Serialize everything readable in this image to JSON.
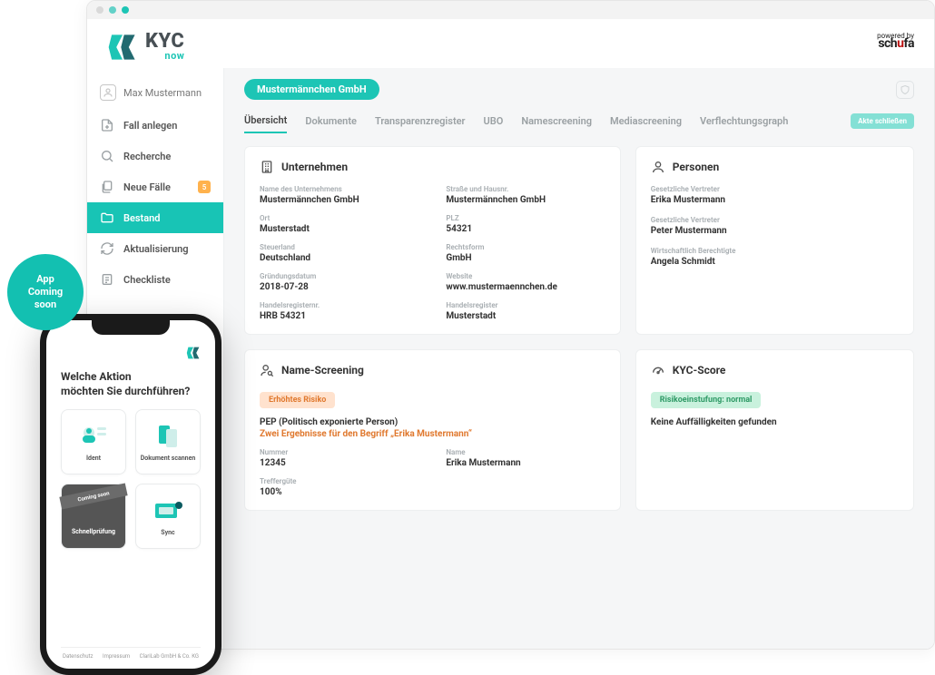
{
  "logo": {
    "kyc": "KYC",
    "now": "now"
  },
  "powered": {
    "label": "powered by",
    "brand_prefix": "sch",
    "brand_accent": "u",
    "brand_suffix": "fa"
  },
  "user": {
    "name": "Max Mustermann"
  },
  "sidebar": {
    "items": [
      {
        "label": "Fall anlegen"
      },
      {
        "label": "Recherche"
      },
      {
        "label": "Neue Fälle",
        "badge": "5"
      },
      {
        "label": "Bestand"
      },
      {
        "label": "Aktualisierung"
      },
      {
        "label": "Checkliste"
      }
    ]
  },
  "main": {
    "company_name": "Mustermännchen GmbH",
    "close_label": "Akte schließen",
    "tabs": [
      "Übersicht",
      "Dokumente",
      "Transparenzregister",
      "UBO",
      "Namescreening",
      "Mediascreening",
      "Verflechtungsgraph"
    ],
    "unternehmen": {
      "heading": "Unternehmen",
      "fields": {
        "name_l": "Name des Unternehmens",
        "name_v": "Mustermännchen GmbH",
        "street_l": "Straße und Hausnr.",
        "street_v": "Mustermännchen GmbH",
        "ort_l": "Ort",
        "ort_v": "Musterstadt",
        "plz_l": "PLZ",
        "plz_v": "54321",
        "land_l": "Steuerland",
        "land_v": "Deutschland",
        "form_l": "Rechtsform",
        "form_v": "GmbH",
        "grund_l": "Gründungsdatum",
        "grund_v": "2018-07-28",
        "web_l": "Website",
        "web_v": "www.mustermaennchen.de",
        "hrnr_l": "Handelsregisternr.",
        "hrnr_v": "HRB 54321",
        "hr_l": "Handelsregister",
        "hr_v": "Musterstadt"
      }
    },
    "personen": {
      "heading": "Personen",
      "list": [
        {
          "role": "Gesetzliche Vertreter",
          "name": "Erika Mustermann"
        },
        {
          "role": "Gesetzliche Vertreter",
          "name": "Peter Mustermann"
        },
        {
          "role": "Wirtschaftlich Berechtigte",
          "name": "Angela Schmidt"
        }
      ]
    },
    "namescreening": {
      "heading": "Name-Screening",
      "risk": "Erhöhtes Risiko",
      "pep_title": "PEP (Politisch exponierte Person)",
      "pep_sub": "Zwei Ergebnisse für den Begriff „Erika Mustermann“",
      "nr_l": "Nummer",
      "nr_v": "12345",
      "name_l": "Name",
      "name_v": "Erika Mustermann",
      "tg_l": "Treffergüte",
      "tg_v": "100%"
    },
    "kyc": {
      "heading": "KYC-Score",
      "risk": "Risikoeinstufung: normal",
      "text": "Keine Auffälligkeiten gefunden"
    }
  },
  "phone": {
    "title_l1": "Welche Aktion",
    "title_l2": "möchten Sie durchführen?",
    "cards": [
      {
        "cap": "Ident"
      },
      {
        "cap": "Dokument scannen"
      },
      {
        "cap": "Schnellprüfung",
        "dark": true,
        "ribbon": "Coming soon"
      },
      {
        "cap": "Sync"
      }
    ],
    "footer": [
      "Datenschutz",
      "Impressum",
      "ClariLab GmbH & Co. KG"
    ]
  },
  "bubble": {
    "l1": "App",
    "l2": "Coming",
    "l3": "soon"
  }
}
